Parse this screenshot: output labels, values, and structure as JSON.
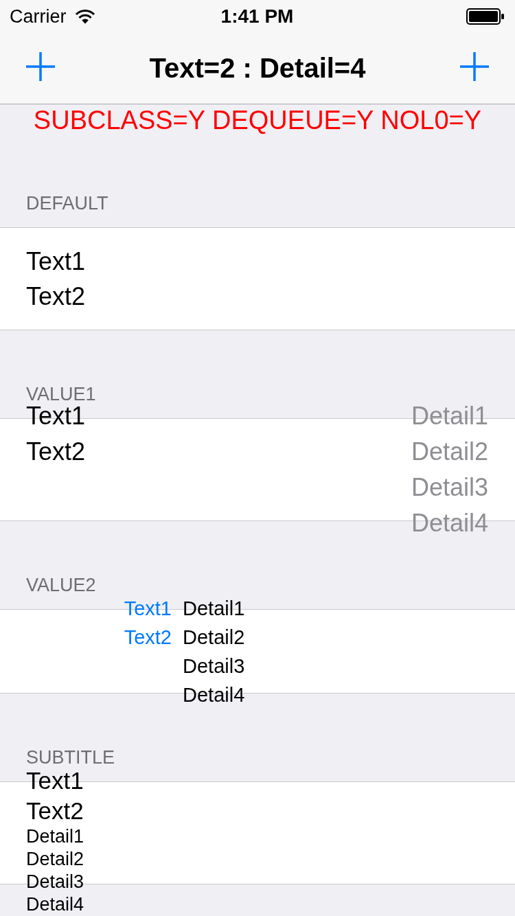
{
  "status_bar": {
    "carrier": "Carrier",
    "time": "1:41 PM"
  },
  "nav_bar": {
    "title": "Text=2 : Detail=4"
  },
  "table_header": "SUBCLASS=Y DEQUEUE=Y NOL0=Y",
  "sections": [
    {
      "header": "DEFAULT",
      "cell": {
        "kind": "default",
        "texts": [
          "Text1",
          "Text2"
        ]
      }
    },
    {
      "header": "VALUE1",
      "cell": {
        "kind": "value1",
        "texts": [
          "Text1",
          "Text2"
        ],
        "details": [
          "Detail1",
          "Detail2",
          "Detail3",
          "Detail4"
        ]
      }
    },
    {
      "header": "VALUE2",
      "cell": {
        "kind": "value2",
        "texts": [
          "Text1",
          "Text2"
        ],
        "details": [
          "Detail1",
          "Detail2",
          "Detail3",
          "Detail4"
        ]
      }
    },
    {
      "header": "SUBTITLE",
      "cell": {
        "kind": "subtitle",
        "texts": [
          "Text1",
          "Text2"
        ],
        "details": [
          "Detail1",
          "Detail2",
          "Detail3",
          "Detail4"
        ]
      }
    }
  ]
}
